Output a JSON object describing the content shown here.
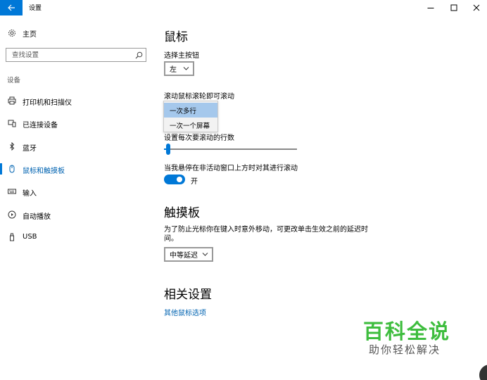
{
  "window": {
    "title": "设置",
    "accent": "#0078d7"
  },
  "sidebar": {
    "home_label": "主页",
    "search_placeholder": "查找设置",
    "section_label": "设备",
    "items": [
      {
        "label": "打印机和扫描仪",
        "icon": "printer-icon"
      },
      {
        "label": "已连接设备",
        "icon": "connected-devices-icon"
      },
      {
        "label": "蓝牙",
        "icon": "bluetooth-icon"
      },
      {
        "label": "鼠标和触摸板",
        "icon": "mouse-icon",
        "active": true
      },
      {
        "label": "输入",
        "icon": "keyboard-icon"
      },
      {
        "label": "自动播放",
        "icon": "autoplay-icon"
      },
      {
        "label": "USB",
        "icon": "usb-icon"
      }
    ]
  },
  "mouse": {
    "heading": "鼠标",
    "primary_button_label": "选择主按钮",
    "primary_button_value": "左",
    "scroll_label": "滚动鼠标滚轮即可滚动",
    "scroll_options": [
      "一次多行",
      "一次一个屏幕"
    ],
    "scroll_selected": "一次多行",
    "lines_label": "设置每次要滚动的行数",
    "lines_level": 0.02,
    "inactive_scroll_label": "当我悬停在非活动窗口上方时对其进行滚动",
    "inactive_scroll_state": "开"
  },
  "touchpad": {
    "heading": "触摸板",
    "delay_description": "为了防止光标你在键入时意外移动，可更改单击生效之前的延迟时间。",
    "delay_value": "中等延迟"
  },
  "related": {
    "heading": "相关设置",
    "link": "其他鼠标选项"
  },
  "watermark": {
    "main": "百科全说",
    "sub": "助你轻松解决",
    "color": "#3ebd3e"
  }
}
